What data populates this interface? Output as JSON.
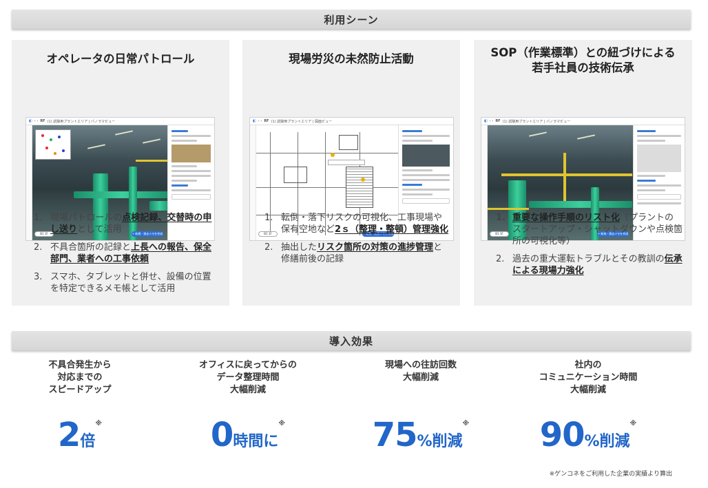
{
  "usage_header": "利用シーン",
  "cards": [
    {
      "title_lines": [
        "オペレータの日常パトロール",
        ""
      ],
      "screenshot": {
        "breadcrumb": "(1) 試験用プラントエリア | パノラマビュー",
        "button": "+ 新規・過去メモを作成",
        "badge": "B1 1F"
      },
      "items": [
        {
          "num": "1.",
          "pre": "現場パトロールの",
          "bold": "点検記録、交替時の申し送り",
          "post": "として活用"
        },
        {
          "num": "2.",
          "pre": "不具合箇所の記録と",
          "bold": "上長への報告、保全部門、業者への工事依頼",
          "post": ""
        },
        {
          "num": "3.",
          "pre": "スマホ、タブレットと併せ、設備の位置を特定できるメモ帳として活用",
          "bold": "",
          "post": ""
        }
      ]
    },
    {
      "title_lines": [
        "現場労災の未然防止活動",
        ""
      ],
      "screenshot": {
        "breadcrumb": "(1) 試験用プラントエリア | 図面ビュー",
        "button": "+ 新規・過去メモを作成",
        "badge": "B1 1F"
      },
      "items": [
        {
          "num": "1.",
          "pre": "転倒・落下リスクの可視化、工事現場や保有空地など",
          "bold": "2ｓ（整理・整頓）管理強化",
          "post": ""
        },
        {
          "num": "2.",
          "pre": "抽出した",
          "bold": "リスク箇所の対策の進捗管理",
          "post": "と修繕前後の記録"
        }
      ]
    },
    {
      "title_lines": [
        "SOP（作業標準）との紐づけによる",
        "若手社員の技術伝承"
      ],
      "screenshot": {
        "breadcrumb": "(1) 試験用プラントエリア | パノラマビュー",
        "button": "+ 新規・過去メモを作成",
        "badge": "B1 1F"
      },
      "items": [
        {
          "num": "1.",
          "pre": "",
          "bold": "重要な操作手順のリスト化",
          "post": "（プラントのスタートアップ・シャットダウンや点検箇所の可視化等）"
        },
        {
          "num": "2.",
          "pre": "過去の重大運転トラブルとその教訓の",
          "bold": "伝承による現場力強化",
          "post": ""
        }
      ]
    }
  ],
  "effects_header": "導入効果",
  "effects": [
    {
      "heading": "不具合発生から\n対応までの\nスピードアップ",
      "value": "2",
      "unit": "倍",
      "mark": "※"
    },
    {
      "heading": "オフィスに戻ってからの\nデータ整理時間\n大幅削減",
      "value": "0",
      "unit": "時間に",
      "mark": "※"
    },
    {
      "heading": "現場への往訪回数\n大幅削減",
      "value": "75",
      "unit": "%削減",
      "mark": "※"
    },
    {
      "heading": "社内の\nコミュニケーション時間\n大幅削減",
      "value": "90",
      "unit": "%削減",
      "mark": "※"
    }
  ],
  "footnote": "※ゲンコネをご利用した企業の実績より算出",
  "colors": {
    "accent": "#2166c8",
    "header_bg": "#dcdcdc",
    "card_bg": "#f0f0f0"
  }
}
